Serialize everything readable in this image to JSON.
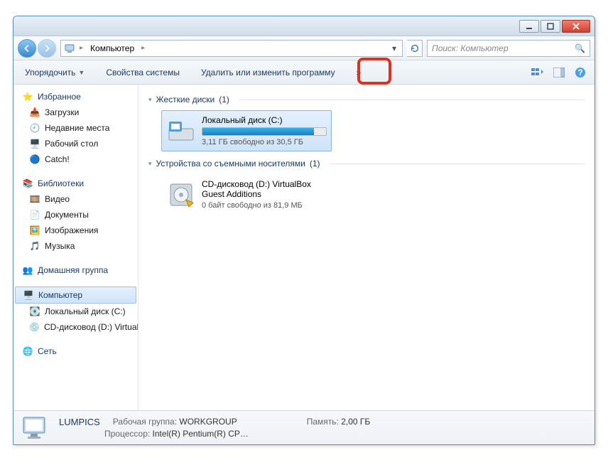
{
  "window": {
    "breadcrumb_root": "Компьютер",
    "search_placeholder": "Поиск: Компьютер"
  },
  "toolbar": {
    "organize": "Упорядочить",
    "system_props": "Свойства системы",
    "uninstall": "Удалить или изменить программу",
    "more": "»"
  },
  "sidebar": {
    "favorites": {
      "label": "Избранное",
      "items": [
        {
          "label": "Загрузки",
          "icon": "downloads"
        },
        {
          "label": "Недавние места",
          "icon": "recent"
        },
        {
          "label": "Рабочий стол",
          "icon": "desktop"
        },
        {
          "label": "Catch!",
          "icon": "catch"
        }
      ]
    },
    "libraries": {
      "label": "Библиотеки",
      "items": [
        {
          "label": "Видео",
          "icon": "video"
        },
        {
          "label": "Документы",
          "icon": "docs"
        },
        {
          "label": "Изображения",
          "icon": "pics"
        },
        {
          "label": "Музыка",
          "icon": "music"
        }
      ]
    },
    "homegroup": {
      "label": "Домашняя группа"
    },
    "computer": {
      "label": "Компьютер",
      "items": [
        {
          "label": "Локальный диск (C:)",
          "icon": "hdd"
        },
        {
          "label": "CD-дисковод (D:) VirtualBox Guest Additions",
          "icon": "cd"
        }
      ]
    },
    "network": {
      "label": "Сеть"
    }
  },
  "content": {
    "section_hdd": {
      "title": "Жесткие диски",
      "count": "(1)"
    },
    "drive_c": {
      "name": "Локальный диск (C:)",
      "free_text": "3,11 ГБ свободно из 30,5 ГБ",
      "fill_pct": 90
    },
    "section_removable": {
      "title": "Устройства со съемными носителями",
      "count": "(1)"
    },
    "drive_d": {
      "name": "CD-дисковод (D:) VirtualBox Guest Additions",
      "free_text": "0 байт свободно из 81,9 МБ"
    }
  },
  "status": {
    "computer_name": "LUMPICS",
    "workgroup_label": "Рабочая группа:",
    "workgroup": "WORKGROUP",
    "memory_label": "Память:",
    "memory": "2,00 ГБ",
    "cpu_label": "Процессор:",
    "cpu": "Intel(R) Pentium(R) CP…"
  }
}
